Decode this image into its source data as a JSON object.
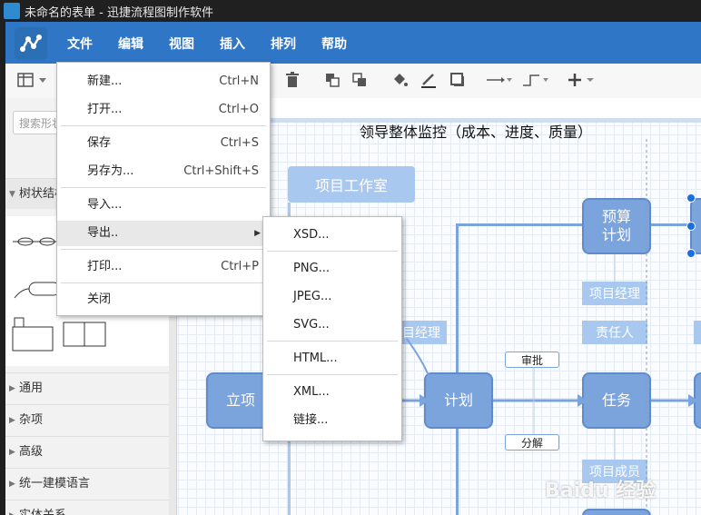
{
  "window": {
    "title": "未命名的表单 - 迅捷流程图制作软件"
  },
  "menubar": {
    "items": [
      "文件",
      "编辑",
      "视图",
      "插入",
      "排列",
      "帮助"
    ]
  },
  "sidebar": {
    "search_placeholder": "搜索形状",
    "expanded_section": "树状结构",
    "sections": [
      "通用",
      "杂项",
      "高级",
      "统一建模语言",
      "实体关系"
    ]
  },
  "file_menu": {
    "items": [
      {
        "label": "新建...",
        "shortcut": "Ctrl+N"
      },
      {
        "label": "打开...",
        "shortcut": "Ctrl+O"
      },
      {
        "label": "保存",
        "shortcut": "Ctrl+S"
      },
      {
        "label": "另存为...",
        "shortcut": "Ctrl+Shift+S"
      },
      {
        "label": "导入...",
        "shortcut": ""
      },
      {
        "label": "导出..",
        "shortcut": ""
      },
      {
        "label": "打印...",
        "shortcut": "Ctrl+P"
      },
      {
        "label": "关闭",
        "shortcut": ""
      }
    ]
  },
  "export_submenu": {
    "items": [
      "XSD...",
      "PNG...",
      "JPEG...",
      "SVG...",
      "HTML...",
      "XML...",
      "链接..."
    ]
  },
  "canvas": {
    "title": "领导整体监控（成本、进度、质量）",
    "studio_label": "项目工作室",
    "nodes": {
      "start": "立项",
      "plan": "计划",
      "task": "任务",
      "budget": "预算\n计划"
    },
    "labels": {
      "pm1": "项目经理",
      "pm2": "目经理",
      "owner": "责任人",
      "member": "项目成员"
    },
    "small": {
      "approve": "审批",
      "decompose": "分解"
    }
  },
  "watermark": "Baidu 经验",
  "colors": {
    "menubar": "#2f76c7",
    "node": "#7ba3dc",
    "highlight": "#7a0000"
  }
}
